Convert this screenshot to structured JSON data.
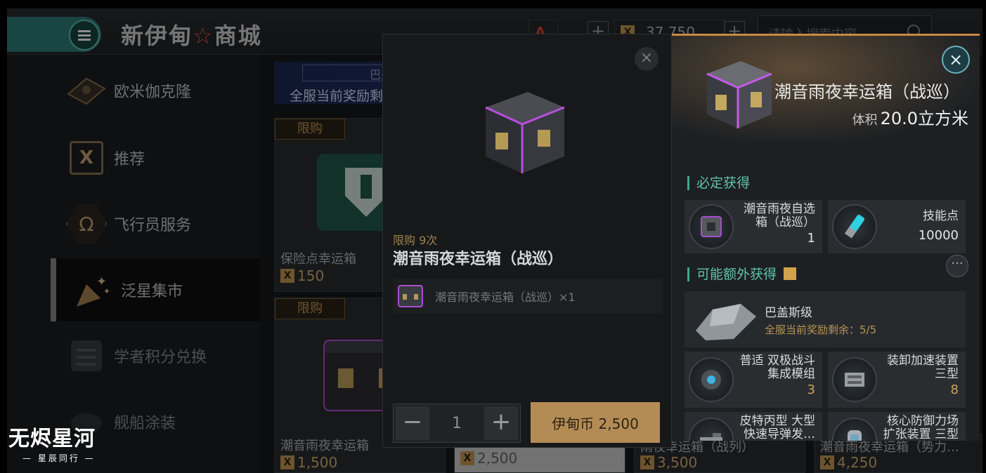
{
  "header": {
    "menu_icon": "hamburger-icon",
    "title_left": "新伊甸",
    "title_star": "☆",
    "title_right": "商城",
    "currency_1_icon": "A",
    "currency_2_icon": "X",
    "currency_2_amount": "37,750",
    "plus": "+",
    "search_placeholder": "请输入搜索内容"
  },
  "sidebar": {
    "items": [
      {
        "label": "欧米伽克隆",
        "icon": "omega-clone-icon"
      },
      {
        "label": "推荐",
        "icon": "recommend-icon",
        "glyph": "X"
      },
      {
        "label": "飞行员服务",
        "icon": "pilot-service-icon",
        "glyph": "Ω"
      },
      {
        "label": "泛星集市",
        "icon": "star-market-icon",
        "glyph": "✦"
      },
      {
        "label": "学者积分兑换",
        "icon": "scholar-points-icon"
      },
      {
        "label": "舰船涂装",
        "icon": "ship-skin-icon"
      }
    ]
  },
  "grid": {
    "banner_title": "巴盖斯",
    "banner_subtitle": "全服当前奖励剩",
    "tag_label": "限购",
    "coin_glyph": "X",
    "cards": [
      {
        "name": "保险点幸运箱",
        "price": "150"
      },
      {
        "name": "潮音雨夜幸运箱",
        "price": "1,500"
      },
      {
        "name": "",
        "price": "2,500"
      },
      {
        "name": "雨夜幸运箱（战列）",
        "price": "3,500"
      },
      {
        "name": "潮音雨夜幸运箱（势力…",
        "price": "4,250"
      }
    ]
  },
  "purchase_modal": {
    "close": "×",
    "limit_text": "限购 9次",
    "title": "潮音雨夜幸运箱（战巡）",
    "item_text": "潮音雨夜幸运箱（战巡）×1",
    "minus": "−",
    "quantity": "1",
    "plus": "+",
    "buy_label": "伊甸币 2,500"
  },
  "detail": {
    "close": "×",
    "title": "潮音雨夜幸运箱（战巡）",
    "volume_label": "体积",
    "volume_value": "20.0立方米",
    "guaranteed_label": "必定获得",
    "guaranteed": [
      {
        "name": "潮音雨夜自选箱（战巡）",
        "count": "1",
        "icon": "selection-box-icon"
      },
      {
        "name": "技能点",
        "count": "10000",
        "icon": "skill-injector-icon"
      }
    ],
    "extra_label": "可能额外获得",
    "more": "···",
    "featured": {
      "name": "巴盖斯级",
      "remaining": "全服当前奖励剩余：5/5",
      "icon": "battleship-icon"
    },
    "extra": [
      {
        "name": "普适 双极战斗集成模组",
        "count": "3",
        "icon": "combat-module-icon"
      },
      {
        "name": "装卸加速装置 三型",
        "count": "8",
        "icon": "loader-device-icon"
      },
      {
        "name": "皮特丙型 大型快速导弹发…",
        "count": "",
        "icon": "missile-launcher-icon"
      },
      {
        "name": "核心防御力场扩张装置 三型",
        "count": "",
        "icon": "shield-extender-icon"
      }
    ]
  },
  "watermark": {
    "title": "无烬星河",
    "subtitle": "— 星辰同行 —"
  },
  "colors": {
    "accent_teal": "#2e7e78",
    "gold": "#b38c55",
    "section_green": "#5fc4a8",
    "top_border": "#c68a45"
  }
}
